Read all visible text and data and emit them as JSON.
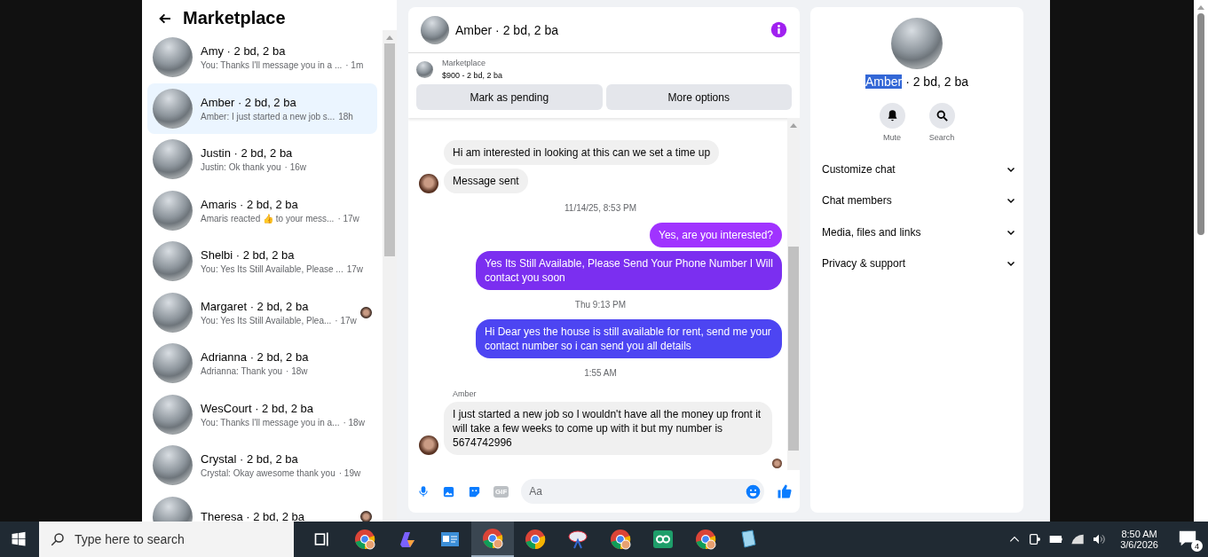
{
  "sidebar": {
    "title": "Marketplace",
    "conversations": [
      {
        "name": "Amy · 2 bd, 2 ba",
        "preview": "You: Thanks I'll message you in a ...",
        "time": "· 1m",
        "selected": false,
        "seen_avatar": false
      },
      {
        "name": "Amber · 2 bd, 2 ba",
        "preview": "Amber: I just started a new job s...",
        "time": "18h",
        "selected": true,
        "seen_avatar": false
      },
      {
        "name": "Justin · 2 bd, 2 ba",
        "preview": "Justin: Ok thank you",
        "time": "· 16w",
        "selected": false,
        "seen_avatar": false
      },
      {
        "name": "Amaris · 2 bd, 2 ba",
        "preview": "Amaris reacted 👍 to your mess...",
        "time": "· 17w",
        "selected": false,
        "seen_avatar": false
      },
      {
        "name": "Shelbi · 2 bd, 2 ba",
        "preview": "You: Yes Its Still Available, Please ...",
        "time": "17w",
        "selected": false,
        "seen_avatar": false
      },
      {
        "name": "Margaret · 2 bd, 2 ba",
        "preview": "You: Yes Its Still Available, Plea...",
        "time": "· 17w",
        "selected": false,
        "seen_avatar": true
      },
      {
        "name": "Adrianna · 2 bd, 2 ba",
        "preview": "Adrianna: Thank you",
        "time": "· 18w",
        "selected": false,
        "seen_avatar": false
      },
      {
        "name": "WesCourt · 2 bd, 2 ba",
        "preview": "You: Thanks I'll message you in a...",
        "time": "· 18w",
        "selected": false,
        "seen_avatar": false
      },
      {
        "name": "Crystal · 2 bd, 2 ba",
        "preview": "Crystal: Okay awesome thank you",
        "time": "· 19w",
        "selected": false,
        "seen_avatar": false
      },
      {
        "name": "Theresa · 2 bd, 2 ba",
        "selected": false,
        "seen_avatar": true
      }
    ]
  },
  "chat": {
    "title": "Amber · 2 bd, 2 ba",
    "listing": {
      "source": "Marketplace",
      "price": "$900 - 2 bd, 2 ba"
    },
    "buttons": [
      "Mark as pending",
      "More options"
    ],
    "messages": [
      {
        "kind": "incoming",
        "text": "Hi am interested in looking at this can we set a time up",
        "avatar": false
      },
      {
        "kind": "incoming",
        "text": "Message sent",
        "avatar": true
      },
      {
        "kind": "timestamp",
        "text": "11/14/25, 8:53 PM"
      },
      {
        "kind": "outgoing",
        "text": "Yes, are you interested?",
        "color": "#a033ff"
      },
      {
        "kind": "outgoing",
        "text": "Yes Its Still Available, Please Send Your Phone Number I Will contact you soon",
        "color": "#7b2ff0"
      },
      {
        "kind": "timestamp",
        "text": "Thu 9:13 PM"
      },
      {
        "kind": "outgoing",
        "text": "Hi Dear yes the house is still available for rent, send me your contact number so i can send you all details",
        "color": "#4d45f2"
      },
      {
        "kind": "timestamp",
        "text": "1:55 AM"
      },
      {
        "kind": "sender",
        "text": "Amber"
      },
      {
        "kind": "incoming",
        "text": "I just started a new job so I wouldn't have all the money up front it will take a few weeks to come up with it but my number is 5674742996",
        "avatar": true
      },
      {
        "kind": "seen"
      }
    ],
    "composer": {
      "gif_label": "GIF",
      "placeholder": "Aa"
    }
  },
  "info": {
    "title_parts": [
      {
        "text": "Amber",
        "highlighted": true
      },
      {
        "text": " · 2 bd, 2 ba",
        "highlighted": false
      }
    ],
    "actions": [
      {
        "kind": "mute",
        "label": "Mute"
      },
      {
        "kind": "search",
        "label": "Search"
      }
    ],
    "sections": [
      {
        "label": "Customize chat",
        "expanded": false
      },
      {
        "label": "Chat members",
        "expanded": false
      },
      {
        "label": "Media, files and links",
        "expanded": false
      },
      {
        "label": "Privacy & support",
        "expanded": false
      }
    ]
  },
  "taskbar": {
    "search_placeholder": "Type here to search",
    "time": "8:50 AM",
    "date": "3/6/2026",
    "notifications": "4"
  }
}
